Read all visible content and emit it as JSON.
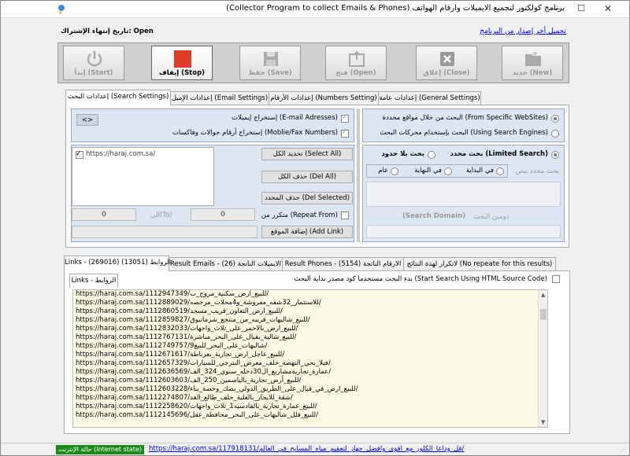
{
  "window": {
    "title": "برنامج كولكتور لتجميع الايميلات وارقام الهواتف (Collector Program to collect Emails & Phones)",
    "minimize": "—",
    "maximize": "☐",
    "close": "✕"
  },
  "top": {
    "update_link": "تحميل أخر إصدار من البرنامج",
    "expiry": "تاريخ إنتهاء الإشتراك: Open"
  },
  "toolbar": {
    "new": "جديد (New)",
    "close": "إغلاق (Close)",
    "open": "فتح (Open)",
    "save": "حفظ (Save)",
    "stop": "إيقاف (Stop)",
    "start": "إبدأ (Start)",
    "colors": {
      "stop": "#e03a2a"
    }
  },
  "tabs": {
    "general": "إعدادات عامة (General Settings)",
    "numbers": "إعدادات الأرقام (Numbers Setting)",
    "email": "إعدادات الإميل (Email Settings)",
    "search": "إعدادات البحث (Search Settings)"
  },
  "search": {
    "specific_sites": "البحث من خلال مواقع محددة (From Specific WebSites)",
    "search_engines": "البحث بإستخدام محركات البحث (Using Search Engines)",
    "limited": "بحث محدد (Limited Search)",
    "unlimited": "بحث بلا حدود",
    "limited_text": "بحث محدد بنص",
    "match_all": "عام",
    "match_end": "في النهاية",
    "match_start": "في البداية",
    "search_domain": "(Search Domain)",
    "search_domain_ar": "دومين البحث",
    "extract_emails": "إستخراج إيميلات (E-mail Adresses)",
    "extract_phones": "إستخراج أرقام جوالات وفاكسات (Moblie/Fax Numbers)",
    "swap_btn": "<>",
    "url_item": "https://haraj.com.sa/",
    "select_all": "تحديد الكل (Select All)",
    "del_all": "حذف الكل (Del All)",
    "del_selected": "حذف المحدد (Del Selected)",
    "repeat_from": "متكرر من (Repeat From)",
    "repeat_from_val": "0",
    "to_label": "الى(To)",
    "to_val": "0",
    "add_link": "إضافة الموقع (Add Link)"
  },
  "results_tabs": {
    "no_repeat": "لاتكرار لهذة النتائج (No repeate for this results)",
    "phones": "Result Phones - الارقام الناتجة (5154)",
    "emails": "Result Emails - الايميلات الناتجة (26)",
    "links": "Links - الروابط (13051) (269016)"
  },
  "links_subtab": "Links - الروابط",
  "html_source": "بدء البحث مستخدما كود مصدر بداية البحث (Start Search Using HTML Source Code)",
  "links": [
    "https://haraj.com.sa/1112947349/للبيع_ارض_سكنية_مروج_ب/",
    "https://haraj.com.sa/1112889029/للاستثمار_32شقه_مفروشة_و4محلات_مرخصه/",
    "https://haraj.com.sa/1112860519/للبيع_ارض_التعاون_قريب_مسجد/",
    "https://haraj.com.sa/1112859827/للبيع_شاليهات_قريبه_من_منتجع_شرماتيوق/",
    "https://haraj.com.sa/1112832033/للبيع_ارض_بالاحمر_على_ثلاث_واجهات/",
    "https://haraj.com.sa/1112767131/للبيع_شالية_بقبال_على_البحر_مباشرة/",
    "https://haraj.com.sa/1112749757/9شاليهات_على_البحر_للبيع/",
    "https://haraj.com.sa/1112671617/للبيع_عاجل_ارض_تجارية_بعرناطة/",
    "https://haraj.com.sa/1112657329/فيلا_بحي_النهضة_خلف_معرض_البترجي_للسيارات/",
    "https://haraj.com.sa/1112636569/عمارة_تجاريةمشاربع_ال30دخله_سنوي_324_الف/",
    "https://haraj.com.sa/1112603603/للبيع_أرض_تجارية_بالياسمين_250_الف/",
    "https://haraj.com.sa/1112603228/للبيع_ارض_في_قبال_على_الطريق_الدولي_بصك_وخصة_بناء/",
    "https://haraj.com.sa/1112274807/شقة_للايجار_بالعلية_خلف_طالع_الغد/",
    "https://haraj.com.sa/1112258620/للبيع_عمارة_تجارية_بالقادسيه1_ثلاث_واجهات/",
    "https://haraj.com.sa/1112145696/للبيع_فلل_شاليهات_على_البحر_محافظة_عقل/"
  ],
  "status": {
    "internet": "حالة الإنترنت (Internet state)",
    "link": "https://haraj.com.sa/117918131/قل_وداعا_الكلور_مع_اقوى_وافضل_جهاز_لتعقيم_مياه_المسابح_في_العالم/",
    "internet_color": "#1a8a1a"
  }
}
